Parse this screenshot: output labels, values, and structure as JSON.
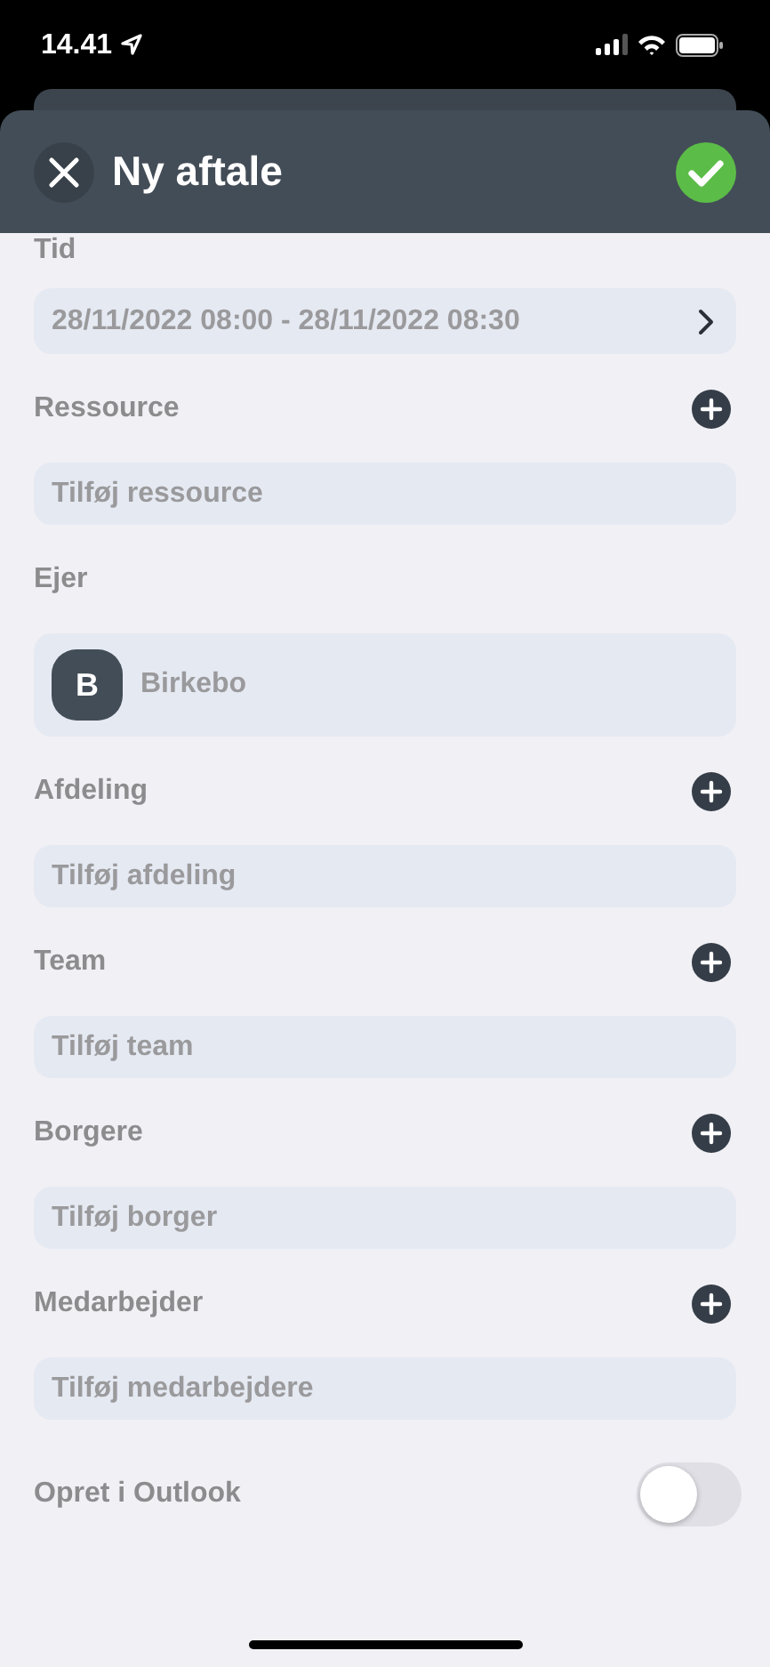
{
  "status_bar": {
    "time": "14.41"
  },
  "header": {
    "title": "Ny aftale"
  },
  "sections": [
    {
      "label": "Tid",
      "kind": "picker",
      "value": "28/11/2022 08:00 - 28/11/2022 08:30"
    },
    {
      "label": "Ressource",
      "kind": "add",
      "placeholder": "Tilføj ressource"
    },
    {
      "label": "Ejer",
      "kind": "owner",
      "initial": "B",
      "value": "Birkebo"
    },
    {
      "label": "Afdeling",
      "kind": "add",
      "placeholder": "Tilføj afdeling"
    },
    {
      "label": "Team",
      "kind": "add",
      "placeholder": "Tilføj team"
    },
    {
      "label": "Borgere",
      "kind": "add",
      "placeholder": "Tilføj borger"
    },
    {
      "label": "Medarbejder",
      "kind": "add",
      "placeholder": "Tilføj medarbejdere"
    }
  ],
  "outlook": {
    "label": "Opret i Outlook",
    "on": false
  }
}
